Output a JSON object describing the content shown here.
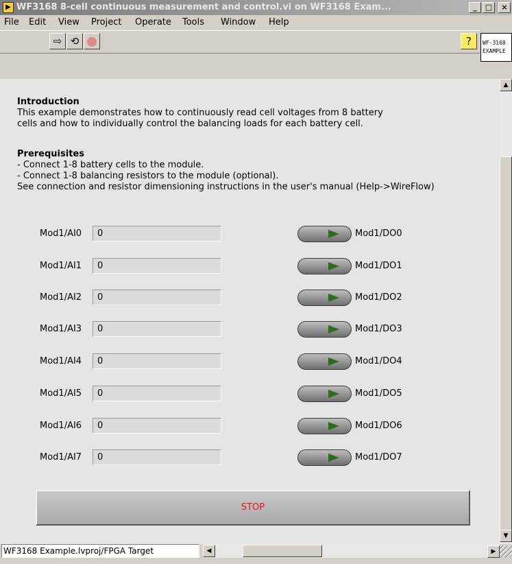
{
  "window": {
    "title": "WF3168 8-cell continuous measurement and control.vi on WF3168 Exam...",
    "controls": {
      "minimize": "_",
      "maximize": "□",
      "close": "×"
    }
  },
  "menu": [
    "File",
    "Edit",
    "View",
    "Project",
    "Operate",
    "Tools",
    "Window",
    "Help"
  ],
  "toolbar": {
    "run_icon": "run-arrow-icon",
    "run_continuous_icon": "run-continuously-icon",
    "abort_icon": "abort-stop-icon",
    "help_icon": "context-help-icon"
  },
  "vi_icon": {
    "line1": "WF-3168",
    "line2": "EXAMPLE"
  },
  "intro": {
    "heading": "Introduction",
    "line1": "This example demonstrates how to continuously read cell voltages from 8 battery",
    "line2": "cells and how to individually control the balancing loads for each battery cell."
  },
  "prereq": {
    "heading": "Prerequisites",
    "line1": "- Connect 1-8 battery cells to the module.",
    "line2": "- Connect 1-8 balancing resistors to the module (optional).",
    "line3": "See connection and resistor dimensioning instructions in the user's manual (Help->WireFlow)"
  },
  "analog_inputs": [
    {
      "label": "Mod1/AI0",
      "value": "0"
    },
    {
      "label": "Mod1/AI1",
      "value": "0"
    },
    {
      "label": "Mod1/AI2",
      "value": "0"
    },
    {
      "label": "Mod1/AI3",
      "value": "0"
    },
    {
      "label": "Mod1/AI4",
      "value": "0"
    },
    {
      "label": "Mod1/AI5",
      "value": "0"
    },
    {
      "label": "Mod1/AI6",
      "value": "0"
    },
    {
      "label": "Mod1/AI7",
      "value": "0"
    }
  ],
  "digital_outputs": [
    {
      "label": "Mod1/DO0",
      "state": "off"
    },
    {
      "label": "Mod1/DO1",
      "state": "off"
    },
    {
      "label": "Mod1/DO2",
      "state": "off"
    },
    {
      "label": "Mod1/DO3",
      "state": "off"
    },
    {
      "label": "Mod1/DO4",
      "state": "off"
    },
    {
      "label": "Mod1/DO5",
      "state": "off"
    },
    {
      "label": "Mod1/DO6",
      "state": "off"
    },
    {
      "label": "Mod1/DO7",
      "state": "off"
    }
  ],
  "stop_button": {
    "label": "STOP",
    "color": "#ee1111"
  },
  "status_bar": {
    "path": "WF3168 Example.lvproj/FPGA Target"
  }
}
